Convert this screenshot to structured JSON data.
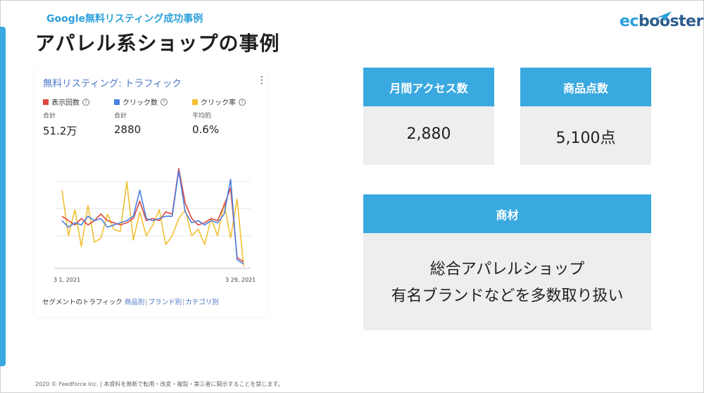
{
  "slide": {
    "subtitle": "Google無料リスティング成功事例",
    "title": "アパレル系ショップの事例",
    "logo": {
      "prefix": "ec",
      "suffix": "booster"
    },
    "footer": "2020 © Feedforce Inc. | 本資料を無断で転用・改変・複製・第三者に開示することを禁じます。"
  },
  "card": {
    "title": "無料リスティング: トラフィック",
    "menu_icon": "⋮",
    "legend": [
      {
        "label": "表示回数",
        "color": "#e0463f"
      },
      {
        "label": "クリック数",
        "color": "#4a80e0"
      },
      {
        "label": "クリック率",
        "color": "#f3c032"
      }
    ],
    "metrics": [
      {
        "caption": "合計",
        "value": "51.2万"
      },
      {
        "caption": "合計",
        "value": "2880"
      },
      {
        "caption": "平均的",
        "value": "0.6%"
      }
    ],
    "x_ticks": [
      "3 1, 2021",
      "3 29, 2021"
    ],
    "segment_label": "セグメントのトラフィック",
    "segment_links": [
      "商品別",
      "ブランド別",
      "カテゴリ別"
    ]
  },
  "chart_data": {
    "type": "line",
    "x": [
      "3 1, 2021",
      "",
      "",
      "",
      "",
      "",
      "",
      "",
      "",
      "",
      "",
      "",
      "",
      "",
      "",
      "",
      "",
      "",
      "",
      "",
      "",
      "",
      "",
      "",
      "",
      "",
      "",
      "",
      "3 29, 2021"
    ],
    "series": [
      {
        "name": "表示回数",
        "values": [
          48,
          44,
          40,
          46,
          40,
          44,
          50,
          44,
          42,
          40,
          42,
          46,
          62,
          44,
          46,
          44,
          52,
          50,
          92,
          60,
          46,
          40,
          42,
          46,
          44,
          58,
          74,
          10,
          6
        ]
      },
      {
        "name": "クリック数",
        "values": [
          44,
          38,
          42,
          40,
          48,
          44,
          46,
          38,
          40,
          42,
          44,
          48,
          72,
          46,
          44,
          46,
          48,
          48,
          90,
          52,
          42,
          44,
          40,
          44,
          42,
          50,
          82,
          8,
          4
        ]
      },
      {
        "name": "クリック率",
        "values": [
          72,
          30,
          54,
          20,
          58,
          24,
          28,
          50,
          36,
          34,
          80,
          26,
          52,
          30,
          40,
          54,
          22,
          30,
          46,
          54,
          30,
          36,
          22,
          46,
          30,
          60,
          28,
          64,
          2
        ]
      }
    ]
  },
  "stats": {
    "monthly_access": {
      "label": "月間アクセス数",
      "value": "2,880"
    },
    "product_count": {
      "label": "商品点数",
      "value": "5,100点"
    },
    "merch": {
      "label": "商材",
      "lines": [
        "総合アパレルショップ",
        "有名ブランドなどを多数取り扱い"
      ]
    }
  }
}
